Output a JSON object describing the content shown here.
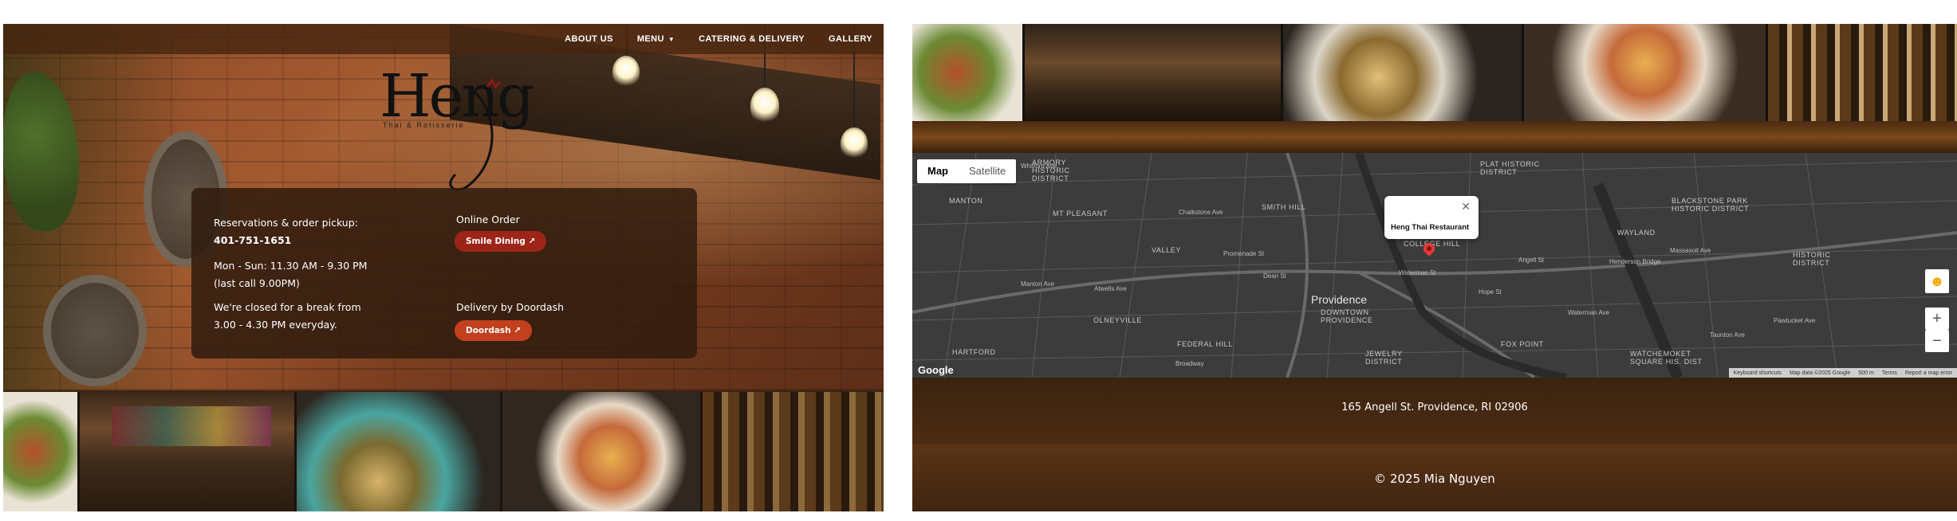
{
  "nav": {
    "items": [
      {
        "label": "ABOUT US"
      },
      {
        "label": "MENU",
        "has_dropdown": true
      },
      {
        "label": "CATERING & DELIVERY"
      },
      {
        "label": "GALLERY"
      }
    ],
    "caret_icon": "chevron-down-icon"
  },
  "logo": {
    "word": "Heng",
    "subtitle": "Thai & Rotisserie"
  },
  "info": {
    "reservations_label": "Reservations & order pickup:",
    "phone": "401-751-1651",
    "hours_line1": "Mon - Sun: 11.30 AM - 9.30 PM",
    "hours_line2": "(last call 9.00PM)",
    "break_line1": "We're closed for a break from",
    "break_line2": "3.00 - 4.30 PM everyday.",
    "online_order_label": "Online Order",
    "smile_button": "Smile Dining ↗",
    "delivery_label": "Delivery by Doordash",
    "doordash_button": "Doordash ↗"
  },
  "map": {
    "type_options": [
      "Map",
      "Satellite"
    ],
    "active_type": "Map",
    "popup_title": "Heng Thai Restaurant",
    "city": "Providence",
    "areas": [
      "MANTON",
      "MT PLEASANT",
      "SMITH HILL",
      "VALLEY",
      "OLNEYVILLE",
      "HARTFORD",
      "FEDERAL HILL",
      "DOWNTOWN PROVIDENCE",
      "JEWELRY DISTRICT",
      "FOX POINT",
      "WAYLAND",
      "WATCHEMOKET SQUARE HIS. DIST",
      "BLACKSTONE PARK HISTORIC DISTRICT",
      "HISTORIC DISTRICT",
      "PLAT HISTORIC DISTRICT",
      "ARMORY HISTORIC DISTRICT",
      "COLLEGE HILL"
    ],
    "streets": [
      "Whitford Ave",
      "Chalkstone Ave",
      "Manton Ave",
      "Atwells Ave",
      "Promenade St",
      "Dean St",
      "Waterman St",
      "Angell St",
      "Hope St",
      "Broadway",
      "Taunton Ave",
      "Henderson Bridge",
      "Pawtucket Ave",
      "Waterman Ave",
      "Massasoit Ave"
    ],
    "google_label": "Google",
    "attribution": [
      "Keyboard shortcuts",
      "Map data ©2025 Google",
      "500 m",
      "Terms",
      "Report a map error"
    ],
    "zoom_in": "+",
    "zoom_out": "−"
  },
  "footer": {
    "address": "165 Angell St. Providence, RI 02906",
    "copyright": "© 2025 Mia Nguyen"
  },
  "colors": {
    "brown_dark": "#3a2414",
    "smile_button": "#9c2418",
    "doordash_button": "#c2401e",
    "map_bg": "#3c3c3c",
    "pin": "#e53935"
  }
}
